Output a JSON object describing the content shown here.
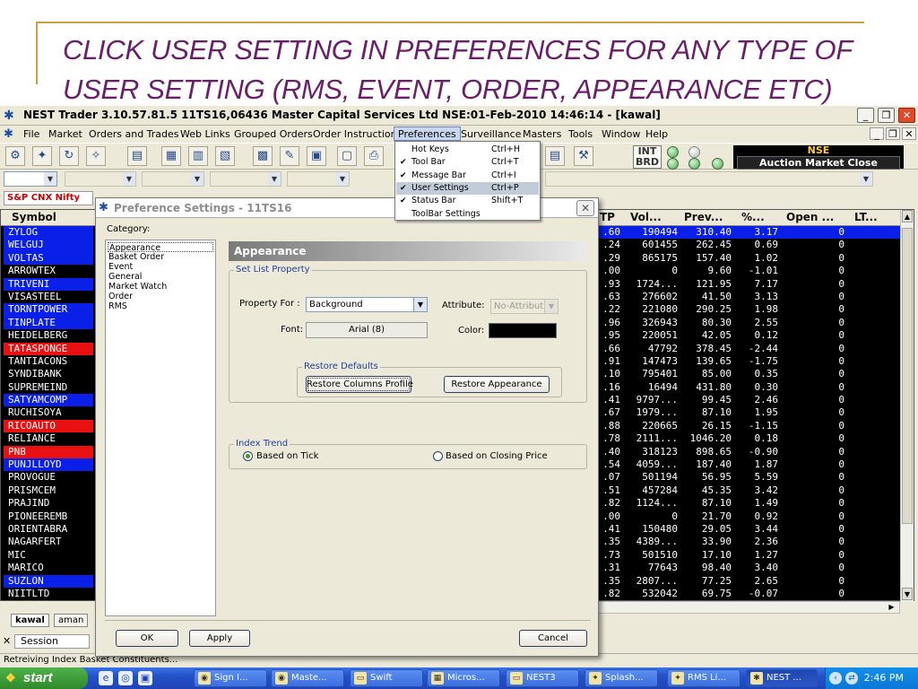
{
  "slide": {
    "title_line1": "CLICK USER SETTING IN PREFERENCES FOR ANY TYPE OF",
    "title_line2": "USER SETTING (RMS, EVENT, ORDER, APPEARANCE ETC)"
  },
  "window": {
    "title": "NEST Trader 3.10.57.81.5 11TS16,06436 Master Capital Services Ltd NSE:01-Feb-2010 14:46:14 - [kawal]",
    "minimize": "_",
    "restore": "❐",
    "close": "✕"
  },
  "menubar": {
    "items": [
      "File",
      "Market",
      "Orders and Trades",
      "Web Links",
      "Grouped Orders",
      "Order Instruction",
      "Preferences",
      "Surveillance",
      "Masters",
      "Tools",
      "Window",
      "Help"
    ],
    "mdi_min": "_",
    "mdi_restore": "❐",
    "mdi_close": "✕"
  },
  "preferences_menu": {
    "items": [
      {
        "label": "Hot Keys",
        "shortcut": "Ctrl+H",
        "checked": ""
      },
      {
        "label": "Tool Bar",
        "shortcut": "Ctrl+T",
        "checked": "✔"
      },
      {
        "label": "Message Bar",
        "shortcut": "Ctrl+I",
        "checked": "✔"
      },
      {
        "label": "User Settings",
        "shortcut": "Ctrl+P",
        "checked": "✔"
      },
      {
        "label": "Status Bar",
        "shortcut": "Shift+T",
        "checked": "✔"
      },
      {
        "label": "ToolBar Settings",
        "shortcut": "",
        "checked": ""
      }
    ]
  },
  "status_panel": {
    "int": "INT",
    "brd": "BRD",
    "exchange": "NSE",
    "market_status": "Auction Market Close"
  },
  "ticker": {
    "index": "S&P CNX Nifty"
  },
  "grid": {
    "headers": {
      "symbol": "Symbol",
      "tp": "TP",
      "vol": "Vol...",
      "prev": "Prev...",
      "pct": "%...",
      "open": "Open ...",
      "lt": "LT..."
    },
    "rows": [
      {
        "symbol": "ZYLOG",
        "color": "blue",
        "tp": ".60",
        "vol": "190494",
        "prev": "310.40",
        "pct": "3.17",
        "oi": "0",
        "selected": true
      },
      {
        "symbol": "WELGUJ",
        "color": "blue",
        "tp": ".24",
        "vol": "601455",
        "prev": "262.45",
        "pct": "0.69",
        "oi": "0"
      },
      {
        "symbol": "VOLTAS",
        "color": "blue",
        "tp": ".29",
        "vol": "865175",
        "prev": "157.40",
        "pct": "1.02",
        "oi": "0"
      },
      {
        "symbol": "ARROWTEX",
        "color": "black",
        "tp": ".00",
        "vol": "0",
        "prev": "9.60",
        "pct": "-1.01",
        "oi": "0"
      },
      {
        "symbol": "TRIVENI",
        "color": "blue",
        "tp": ".93",
        "vol": "1724...",
        "prev": "121.95",
        "pct": "7.17",
        "oi": "0"
      },
      {
        "symbol": "VISASTEEL",
        "color": "black",
        "tp": ".63",
        "vol": "276602",
        "prev": "41.50",
        "pct": "3.13",
        "oi": "0"
      },
      {
        "symbol": "TORNTPOWER",
        "color": "blue",
        "tp": ".22",
        "vol": "221080",
        "prev": "290.25",
        "pct": "1.98",
        "oi": "0"
      },
      {
        "symbol": "TINPLATE",
        "color": "blue",
        "tp": ".96",
        "vol": "326943",
        "prev": "80.30",
        "pct": "2.55",
        "oi": "0"
      },
      {
        "symbol": "HEIDELBERG",
        "color": "black",
        "tp": ".95",
        "vol": "220051",
        "prev": "42.05",
        "pct": "0.12",
        "oi": "0"
      },
      {
        "symbol": "TATASPONGE",
        "color": "red",
        "tp": ".66",
        "vol": "47792",
        "prev": "378.45",
        "pct": "-2.44",
        "oi": "0"
      },
      {
        "symbol": "TANTIACONS",
        "color": "black",
        "tp": ".91",
        "vol": "147473",
        "prev": "139.65",
        "pct": "-1.75",
        "oi": "0"
      },
      {
        "symbol": "SYNDIBANK",
        "color": "black",
        "tp": ".10",
        "vol": "795401",
        "prev": "85.00",
        "pct": "0.35",
        "oi": "0"
      },
      {
        "symbol": "SUPREMEIND",
        "color": "black",
        "tp": ".16",
        "vol": "16494",
        "prev": "431.80",
        "pct": "0.30",
        "oi": "0"
      },
      {
        "symbol": "SATYAMCOMP",
        "color": "blue",
        "tp": ".41",
        "vol": "9797...",
        "prev": "99.45",
        "pct": "2.46",
        "oi": "0"
      },
      {
        "symbol": "RUCHISOYA",
        "color": "black",
        "tp": ".67",
        "vol": "1979...",
        "prev": "87.10",
        "pct": "1.95",
        "oi": "0"
      },
      {
        "symbol": "RICOAUTO",
        "color": "red",
        "tp": ".88",
        "vol": "220665",
        "prev": "26.15",
        "pct": "-1.15",
        "oi": "0"
      },
      {
        "symbol": "RELIANCE",
        "color": "black",
        "tp": ".78",
        "vol": "2111...",
        "prev": "1046.20",
        "pct": "0.18",
        "oi": "0"
      },
      {
        "symbol": "PNB",
        "color": "red",
        "tp": ".40",
        "vol": "318123",
        "prev": "898.65",
        "pct": "-0.90",
        "oi": "0"
      },
      {
        "symbol": "PUNJLLOYD",
        "color": "blue",
        "tp": ".54",
        "vol": "4059...",
        "prev": "187.40",
        "pct": "1.87",
        "oi": "0"
      },
      {
        "symbol": "PROVOGUE",
        "color": "black",
        "tp": ".07",
        "vol": "501194",
        "prev": "56.95",
        "pct": "5.59",
        "oi": "0"
      },
      {
        "symbol": "PRISMCEM",
        "color": "black",
        "tp": ".51",
        "vol": "457284",
        "prev": "45.35",
        "pct": "3.42",
        "oi": "0"
      },
      {
        "symbol": "PRAJIND",
        "color": "black",
        "tp": ".82",
        "vol": "1124...",
        "prev": "87.10",
        "pct": "1.49",
        "oi": "0"
      },
      {
        "symbol": "PIONEEREMB",
        "color": "black",
        "tp": ".00",
        "vol": "0",
        "prev": "21.70",
        "pct": "0.92",
        "oi": "0"
      },
      {
        "symbol": "ORIENTABRA",
        "color": "black",
        "tp": ".41",
        "vol": "150480",
        "prev": "29.05",
        "pct": "3.44",
        "oi": "0"
      },
      {
        "symbol": "NAGARFERT",
        "color": "black",
        "tp": ".35",
        "vol": "4389...",
        "prev": "33.90",
        "pct": "2.36",
        "oi": "0"
      },
      {
        "symbol": "MIC",
        "color": "black",
        "tp": ".73",
        "vol": "501510",
        "prev": "17.10",
        "pct": "1.27",
        "oi": "0"
      },
      {
        "symbol": "MARICO",
        "color": "black",
        "tp": ".31",
        "vol": "77643",
        "prev": "98.40",
        "pct": "3.40",
        "oi": "0"
      },
      {
        "symbol": "SUZLON",
        "color": "blue",
        "tp": ".35",
        "vol": "2807...",
        "prev": "77.25",
        "pct": "2.65",
        "oi": "0"
      },
      {
        "symbol": "NIITLTD",
        "color": "black",
        "tp": ".82",
        "vol": "532042",
        "prev": "69.75",
        "pct": "-0.07",
        "oi": "0"
      }
    ]
  },
  "tabs": [
    "kawal",
    "aman"
  ],
  "session": {
    "close": "✕",
    "label": "Session"
  },
  "status_bar": "Retreiving Index Basket Constituents...",
  "dialog": {
    "title": "Preference Settings - 11TS16",
    "close": "✕",
    "category_label": "Category:",
    "categories": [
      "Appearance",
      "Basket Order",
      "Event",
      "General",
      "Market Watch",
      "Order",
      "RMS"
    ],
    "panel_header": "Appearance",
    "set_list_legend": "Set List Property",
    "property_for_label": "Property For :",
    "property_for_value": "Background",
    "attribute_label": "Attribute:",
    "attribute_value": "No-Attribut",
    "font_label": "Font:",
    "font_value": "Arial (8)",
    "color_label": "Color:",
    "restore_legend": "Restore Defaults",
    "restore_columns": "Restore Columns Profile",
    "restore_appearance": "Restore Appearance",
    "index_trend_legend": "Index Trend",
    "radio_tick": "Based on Tick",
    "radio_closing": "Based on Closing Price",
    "ok": "OK",
    "apply": "Apply",
    "cancel": "Cancel"
  },
  "taskbar": {
    "start": "start",
    "tasks": [
      "Sign I...",
      "Maste...",
      "Swift",
      "Micros...",
      "NEST3",
      "Splash...",
      "RMS Li...",
      "NEST ..."
    ],
    "clock": "2:46 PM"
  },
  "colors": {
    "title_purple": "#6b1f6b",
    "row_blue": "#0a1fe8",
    "row_red": "#e81010",
    "grid_bg": "#000000"
  }
}
